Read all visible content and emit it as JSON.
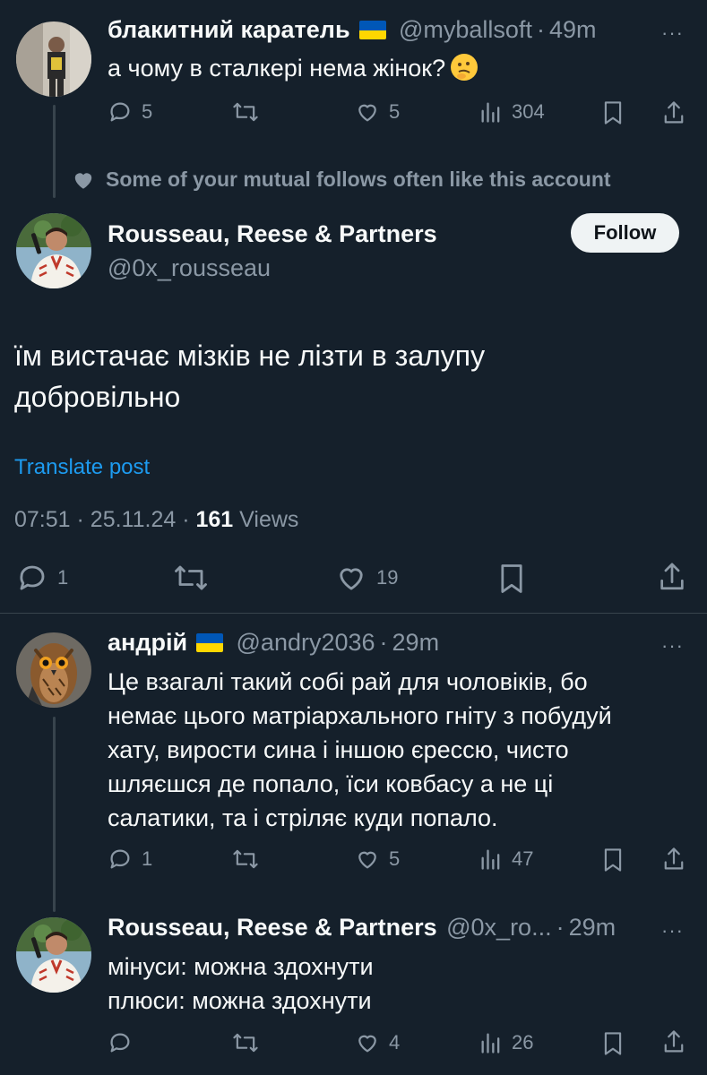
{
  "colors": {
    "background": "#15202b",
    "text": "#f7f9f9",
    "muted": "#8b98a5",
    "link": "#1d9bf0",
    "divider": "#38444d"
  },
  "reply1": {
    "name": "блакитний каратель",
    "handle": "@myballsoft",
    "time": "49m",
    "text": "а чому в сталкері нема жінок?",
    "emoji": "thinking-face",
    "replies": "5",
    "likes": "5",
    "views": "304"
  },
  "social_context": {
    "text": "Some of your mutual follows often like this account",
    "icon": "heart-icon"
  },
  "main_post": {
    "name": "Rousseau, Reese & Partners",
    "handle": "@0x_rousseau",
    "follow_label": "Follow",
    "text_line1": "їм вистачає мізків не лізти в залупу",
    "text_line2": "добровільно",
    "translate_label": "Translate post",
    "time": "07:51",
    "date": "25.11.24",
    "views_count": "161",
    "views_label": "Views",
    "replies": "1",
    "likes": "19"
  },
  "reply2": {
    "name": "андрій",
    "handle": "@andry2036",
    "time": "29m",
    "lines": [
      "Це взагалі такий собі рай для чоловіків, бо",
      "немає цього матріархального гніту з побудуй",
      "хату, вирости сина і іншою єрессю, чисто",
      "шляєшся де попало, їси ковбасу а не ці",
      "салатики, та і стріляє куди попало."
    ],
    "replies": "1",
    "likes": "5",
    "views": "47"
  },
  "reply3": {
    "name": "Rousseau, Reese & Partners",
    "handle": "@0x_ro...",
    "time": "29m",
    "line1": "мінуси: можна здохнути",
    "line2": "плюси: можна здохнути",
    "likes": "4",
    "views": "26"
  },
  "separator": "·",
  "more_icon": "···"
}
